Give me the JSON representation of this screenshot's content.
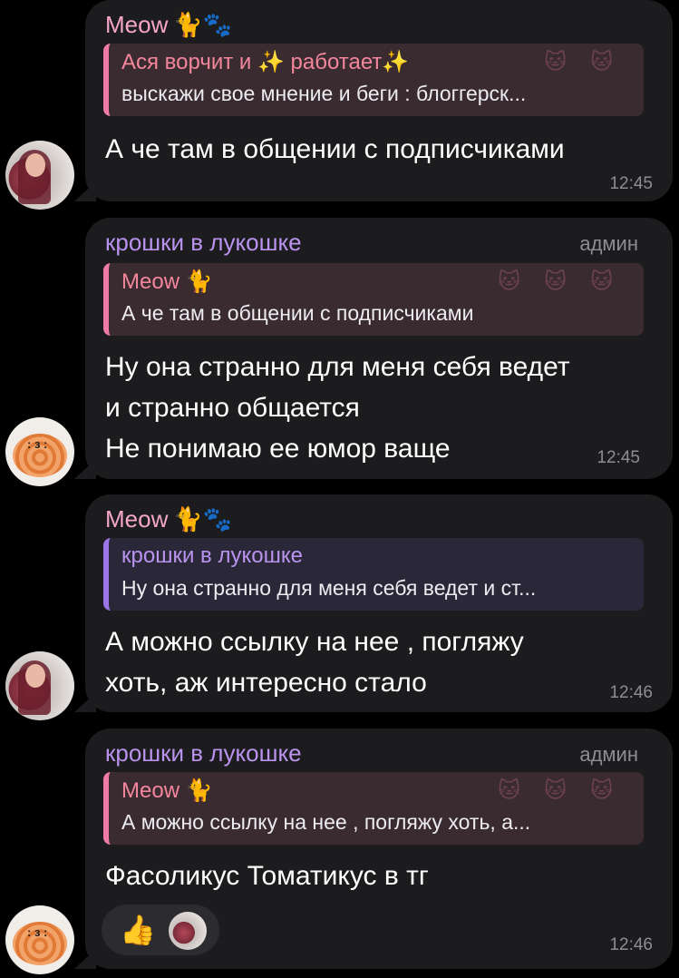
{
  "messages": [
    {
      "sender": "Meow",
      "sender_emoji": "🐈🐾",
      "role": "",
      "reply_title": "Ася ворчит и ✨ работает✨",
      "reply_text": "выскажи свое мнение и беги : блоггерск...",
      "lines": [
        "А че там в общении с подписчиками"
      ],
      "time": "12:45"
    },
    {
      "sender": "крошки в лукошке",
      "sender_emoji": "",
      "role": "админ",
      "reply_title": "Meow 🐈",
      "reply_text": "А че там в общении с подписчиками",
      "lines": [
        "Ну она странно для меня себя ведет",
        "и странно общается",
        "Не понимаю ее юмор ваще"
      ],
      "time": "12:45"
    },
    {
      "sender": "Meow",
      "sender_emoji": "🐈🐾",
      "role": "",
      "reply_title": "крошки в лукошке",
      "reply_text": "Ну она странно для меня себя ведет и ст...",
      "lines": [
        "А можно ссылку на нее , погляжу",
        "хоть, аж интересно стало"
      ],
      "time": "12:46"
    },
    {
      "sender": "крошки в лукошке",
      "sender_emoji": "",
      "role": "админ",
      "reply_title": "Meow 🐈",
      "reply_text": "А можно ссылку на нее , погляжу хоть, а...",
      "lines": [
        "Фасоликус Томатикус в тг"
      ],
      "time": "12:46",
      "reaction": "👍"
    }
  ],
  "icons": {
    "reply_pattern": "cat-pattern",
    "avatar_meow": "user-avatar-photo",
    "avatar_krosh": "cinnamon-roll-avatar"
  },
  "colors": {
    "pink_name": "#f4a6c8",
    "purple_name": "#b993ee",
    "bubble": "#1c1c1e"
  }
}
